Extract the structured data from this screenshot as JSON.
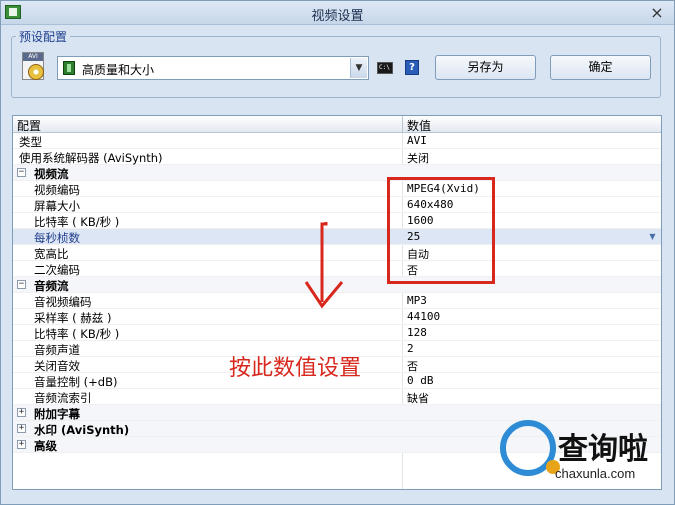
{
  "window": {
    "title": "视频设置",
    "close_glyph": "×"
  },
  "preset": {
    "group_label": "预设配置",
    "selected": "高质量和大小",
    "cmd_glyph": "C:\\",
    "help_glyph": "?",
    "save_as_label": "另存为",
    "ok_label": "确定"
  },
  "grid": {
    "col_name": "配置",
    "col_value": "数值",
    "rows": [
      {
        "name": "类型",
        "value": "AVI"
      },
      {
        "name": "使用系统解码器 (AviSynth)",
        "value": "关闭"
      },
      {
        "name": "视频流",
        "value": "",
        "toggle": "−"
      },
      {
        "name": "视频编码",
        "value": "MPEG4(Xvid)"
      },
      {
        "name": "屏幕大小",
        "value": "640x480"
      },
      {
        "name": "比特率 ( KB/秒 )",
        "value": "1600"
      },
      {
        "name": "每秒桢数",
        "value": "25"
      },
      {
        "name": "宽高比",
        "value": "自动"
      },
      {
        "name": "二次编码",
        "value": "否"
      },
      {
        "name": "音频流",
        "value": "",
        "toggle": "−"
      },
      {
        "name": "音视频编码",
        "value": "MP3"
      },
      {
        "name": "采样率 ( 赫兹 )",
        "value": "44100"
      },
      {
        "name": "比特率 ( KB/秒 )",
        "value": "128"
      },
      {
        "name": "音频声道",
        "value": "2"
      },
      {
        "name": "关闭音效",
        "value": "否"
      },
      {
        "name": "音量控制 (+dB)",
        "value": "0 dB"
      },
      {
        "name": "音频流索引",
        "value": "缺省"
      },
      {
        "name": "附加字幕",
        "value": "",
        "toggle": "+"
      },
      {
        "name": "水印 (AviSynth)",
        "value": "",
        "toggle": "+"
      },
      {
        "name": "高级",
        "value": "",
        "toggle": "+"
      }
    ]
  },
  "annotation": {
    "text": "按此数值设置",
    "color": "#d8281e"
  },
  "watermark": {
    "brand": "查询啦",
    "url": "chaxunla.com"
  },
  "colors": {
    "accent": "#2e8bd6",
    "highlight": "#d8281e",
    "window_bg": "#d8e4f1"
  }
}
